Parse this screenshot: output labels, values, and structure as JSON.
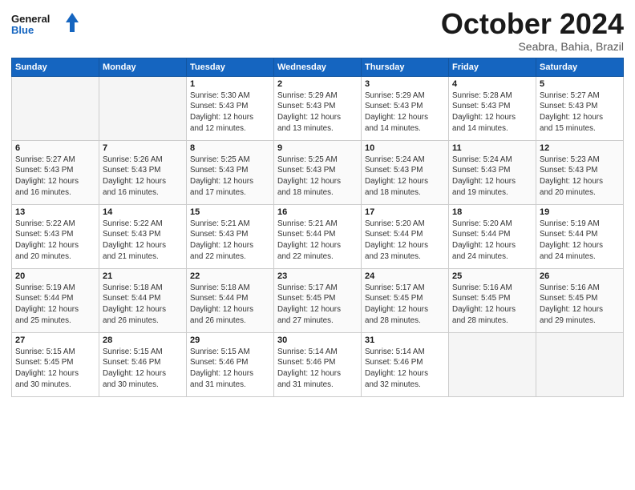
{
  "header": {
    "logo_general": "General",
    "logo_blue": "Blue",
    "month_title": "October 2024",
    "location": "Seabra, Bahia, Brazil"
  },
  "days_of_week": [
    "Sunday",
    "Monday",
    "Tuesday",
    "Wednesday",
    "Thursday",
    "Friday",
    "Saturday"
  ],
  "weeks": [
    [
      {
        "day": "",
        "info": ""
      },
      {
        "day": "",
        "info": ""
      },
      {
        "day": "1",
        "info": "Sunrise: 5:30 AM\nSunset: 5:43 PM\nDaylight: 12 hours\nand 12 minutes."
      },
      {
        "day": "2",
        "info": "Sunrise: 5:29 AM\nSunset: 5:43 PM\nDaylight: 12 hours\nand 13 minutes."
      },
      {
        "day": "3",
        "info": "Sunrise: 5:29 AM\nSunset: 5:43 PM\nDaylight: 12 hours\nand 14 minutes."
      },
      {
        "day": "4",
        "info": "Sunrise: 5:28 AM\nSunset: 5:43 PM\nDaylight: 12 hours\nand 14 minutes."
      },
      {
        "day": "5",
        "info": "Sunrise: 5:27 AM\nSunset: 5:43 PM\nDaylight: 12 hours\nand 15 minutes."
      }
    ],
    [
      {
        "day": "6",
        "info": "Sunrise: 5:27 AM\nSunset: 5:43 PM\nDaylight: 12 hours\nand 16 minutes."
      },
      {
        "day": "7",
        "info": "Sunrise: 5:26 AM\nSunset: 5:43 PM\nDaylight: 12 hours\nand 16 minutes."
      },
      {
        "day": "8",
        "info": "Sunrise: 5:25 AM\nSunset: 5:43 PM\nDaylight: 12 hours\nand 17 minutes."
      },
      {
        "day": "9",
        "info": "Sunrise: 5:25 AM\nSunset: 5:43 PM\nDaylight: 12 hours\nand 18 minutes."
      },
      {
        "day": "10",
        "info": "Sunrise: 5:24 AM\nSunset: 5:43 PM\nDaylight: 12 hours\nand 18 minutes."
      },
      {
        "day": "11",
        "info": "Sunrise: 5:24 AM\nSunset: 5:43 PM\nDaylight: 12 hours\nand 19 minutes."
      },
      {
        "day": "12",
        "info": "Sunrise: 5:23 AM\nSunset: 5:43 PM\nDaylight: 12 hours\nand 20 minutes."
      }
    ],
    [
      {
        "day": "13",
        "info": "Sunrise: 5:22 AM\nSunset: 5:43 PM\nDaylight: 12 hours\nand 20 minutes."
      },
      {
        "day": "14",
        "info": "Sunrise: 5:22 AM\nSunset: 5:43 PM\nDaylight: 12 hours\nand 21 minutes."
      },
      {
        "day": "15",
        "info": "Sunrise: 5:21 AM\nSunset: 5:43 PM\nDaylight: 12 hours\nand 22 minutes."
      },
      {
        "day": "16",
        "info": "Sunrise: 5:21 AM\nSunset: 5:44 PM\nDaylight: 12 hours\nand 22 minutes."
      },
      {
        "day": "17",
        "info": "Sunrise: 5:20 AM\nSunset: 5:44 PM\nDaylight: 12 hours\nand 23 minutes."
      },
      {
        "day": "18",
        "info": "Sunrise: 5:20 AM\nSunset: 5:44 PM\nDaylight: 12 hours\nand 24 minutes."
      },
      {
        "day": "19",
        "info": "Sunrise: 5:19 AM\nSunset: 5:44 PM\nDaylight: 12 hours\nand 24 minutes."
      }
    ],
    [
      {
        "day": "20",
        "info": "Sunrise: 5:19 AM\nSunset: 5:44 PM\nDaylight: 12 hours\nand 25 minutes."
      },
      {
        "day": "21",
        "info": "Sunrise: 5:18 AM\nSunset: 5:44 PM\nDaylight: 12 hours\nand 26 minutes."
      },
      {
        "day": "22",
        "info": "Sunrise: 5:18 AM\nSunset: 5:44 PM\nDaylight: 12 hours\nand 26 minutes."
      },
      {
        "day": "23",
        "info": "Sunrise: 5:17 AM\nSunset: 5:45 PM\nDaylight: 12 hours\nand 27 minutes."
      },
      {
        "day": "24",
        "info": "Sunrise: 5:17 AM\nSunset: 5:45 PM\nDaylight: 12 hours\nand 28 minutes."
      },
      {
        "day": "25",
        "info": "Sunrise: 5:16 AM\nSunset: 5:45 PM\nDaylight: 12 hours\nand 28 minutes."
      },
      {
        "day": "26",
        "info": "Sunrise: 5:16 AM\nSunset: 5:45 PM\nDaylight: 12 hours\nand 29 minutes."
      }
    ],
    [
      {
        "day": "27",
        "info": "Sunrise: 5:15 AM\nSunset: 5:45 PM\nDaylight: 12 hours\nand 30 minutes."
      },
      {
        "day": "28",
        "info": "Sunrise: 5:15 AM\nSunset: 5:46 PM\nDaylight: 12 hours\nand 30 minutes."
      },
      {
        "day": "29",
        "info": "Sunrise: 5:15 AM\nSunset: 5:46 PM\nDaylight: 12 hours\nand 31 minutes."
      },
      {
        "day": "30",
        "info": "Sunrise: 5:14 AM\nSunset: 5:46 PM\nDaylight: 12 hours\nand 31 minutes."
      },
      {
        "day": "31",
        "info": "Sunrise: 5:14 AM\nSunset: 5:46 PM\nDaylight: 12 hours\nand 32 minutes."
      },
      {
        "day": "",
        "info": ""
      },
      {
        "day": "",
        "info": ""
      }
    ]
  ]
}
